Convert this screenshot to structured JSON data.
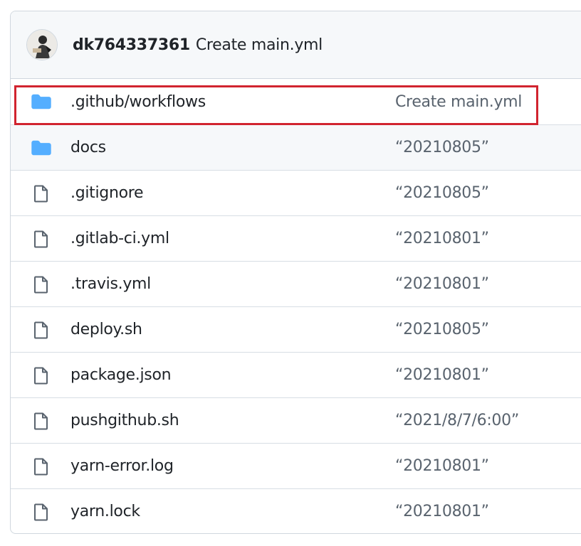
{
  "commit": {
    "author": "dk764337361",
    "message": "Create main.yml"
  },
  "files": [
    {
      "type": "folder",
      "icon": "folder-icon",
      "name": ".github/workflows",
      "message": "Create main.yml"
    },
    {
      "type": "folder",
      "icon": "folder-icon",
      "name": "docs",
      "message": "“20210805”"
    },
    {
      "type": "file",
      "icon": "file-icon",
      "name": ".gitignore",
      "message": "“20210805”"
    },
    {
      "type": "file",
      "icon": "file-icon",
      "name": ".gitlab-ci.yml",
      "message": "“20210801”"
    },
    {
      "type": "file",
      "icon": "file-icon",
      "name": ".travis.yml",
      "message": "“20210801”"
    },
    {
      "type": "file",
      "icon": "file-icon",
      "name": "deploy.sh",
      "message": "“20210805”"
    },
    {
      "type": "file",
      "icon": "file-icon",
      "name": "package.json",
      "message": "“20210801”"
    },
    {
      "type": "file",
      "icon": "file-icon",
      "name": "pushgithub.sh",
      "message": "“2021/8/7/6:00”"
    },
    {
      "type": "file",
      "icon": "file-icon",
      "name": "yarn-error.log",
      "message": "“20210801”"
    },
    {
      "type": "file",
      "icon": "file-icon",
      "name": "yarn.lock",
      "message": "“20210801”"
    }
  ],
  "colors": {
    "folder": "#54aeff",
    "file": "#59636e",
    "highlight": "#d1242f"
  }
}
